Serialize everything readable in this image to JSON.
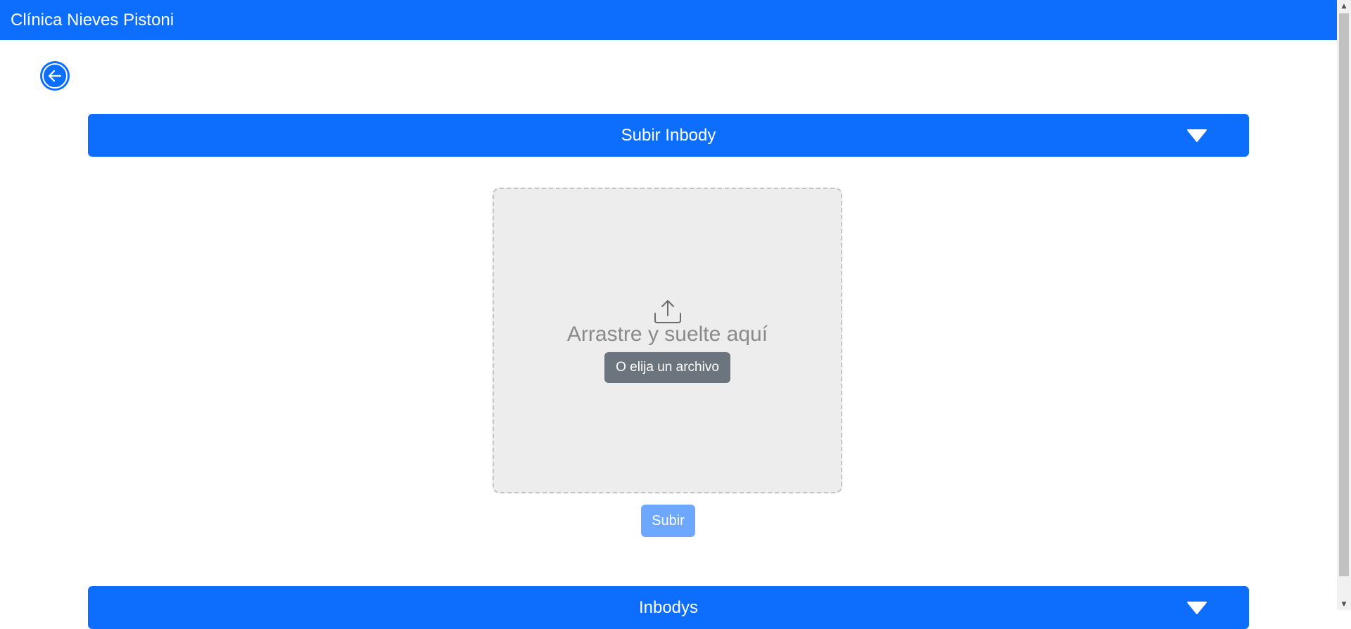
{
  "navbar": {
    "brand": "Clínica Nieves Pistoni",
    "color": "#0d6efd"
  },
  "back_button": {
    "icon": "arrow-left-circle-icon"
  },
  "upload_section": {
    "title": "Subir Inbody",
    "toggle_icon": "caret-down-icon"
  },
  "dropzone": {
    "icon": "upload-icon",
    "text": "Arrastre y suelte aquí",
    "choose_label": "O elija un archivo"
  },
  "submit": {
    "label": "Subir",
    "color": "#6ea8fe"
  },
  "list_section": {
    "title": "Inbodys",
    "toggle_icon": "caret-down-icon"
  }
}
